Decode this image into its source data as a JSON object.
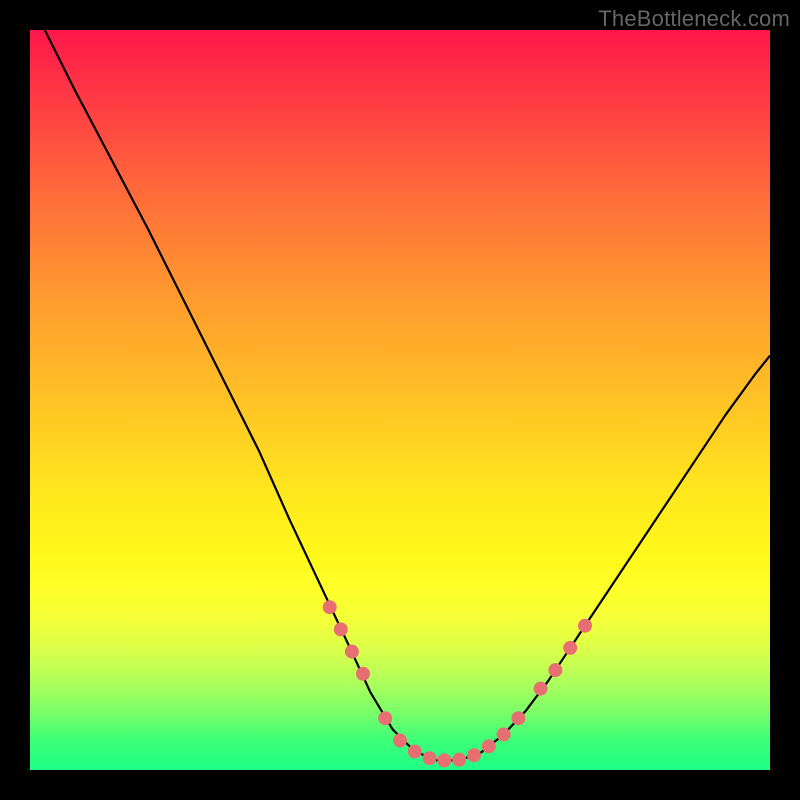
{
  "watermark": "TheBottleneck.com",
  "chart_data": {
    "type": "line",
    "title": "",
    "xlabel": "",
    "ylabel": "",
    "xlim": [
      0,
      100
    ],
    "ylim": [
      0,
      100
    ],
    "curve": {
      "name": "bottleneck-curve",
      "points": [
        {
          "x": 2.0,
          "y": 100.0
        },
        {
          "x": 6.0,
          "y": 92.0
        },
        {
          "x": 11.0,
          "y": 82.5
        },
        {
          "x": 16.0,
          "y": 73.0
        },
        {
          "x": 21.0,
          "y": 63.0
        },
        {
          "x": 26.0,
          "y": 53.0
        },
        {
          "x": 31.0,
          "y": 43.0
        },
        {
          "x": 35.0,
          "y": 34.0
        },
        {
          "x": 39.0,
          "y": 25.5
        },
        {
          "x": 43.0,
          "y": 17.0
        },
        {
          "x": 46.0,
          "y": 10.5
        },
        {
          "x": 49.0,
          "y": 5.5
        },
        {
          "x": 52.0,
          "y": 2.5
        },
        {
          "x": 55.0,
          "y": 1.3
        },
        {
          "x": 58.0,
          "y": 1.3
        },
        {
          "x": 61.0,
          "y": 2.4
        },
        {
          "x": 64.0,
          "y": 4.8
        },
        {
          "x": 67.0,
          "y": 8.0
        },
        {
          "x": 70.0,
          "y": 12.0
        },
        {
          "x": 74.0,
          "y": 18.0
        },
        {
          "x": 78.0,
          "y": 24.0
        },
        {
          "x": 82.0,
          "y": 30.0
        },
        {
          "x": 86.0,
          "y": 36.0
        },
        {
          "x": 90.0,
          "y": 42.0
        },
        {
          "x": 94.0,
          "y": 48.0
        },
        {
          "x": 98.0,
          "y": 53.5
        },
        {
          "x": 100.0,
          "y": 56.0
        }
      ]
    },
    "markers": {
      "name": "highlight-dots",
      "color": "#e76f72",
      "radius_px": 7,
      "points": [
        {
          "x": 40.5,
          "y": 22.0
        },
        {
          "x": 42.0,
          "y": 19.0
        },
        {
          "x": 43.5,
          "y": 16.0
        },
        {
          "x": 45.0,
          "y": 13.0
        },
        {
          "x": 48.0,
          "y": 7.0
        },
        {
          "x": 50.0,
          "y": 4.0
        },
        {
          "x": 52.0,
          "y": 2.5
        },
        {
          "x": 54.0,
          "y": 1.6
        },
        {
          "x": 56.0,
          "y": 1.3
        },
        {
          "x": 58.0,
          "y": 1.4
        },
        {
          "x": 60.0,
          "y": 2.0
        },
        {
          "x": 62.0,
          "y": 3.2
        },
        {
          "x": 64.0,
          "y": 4.8
        },
        {
          "x": 66.0,
          "y": 7.0
        },
        {
          "x": 69.0,
          "y": 11.0
        },
        {
          "x": 71.0,
          "y": 13.5
        },
        {
          "x": 73.0,
          "y": 16.5
        },
        {
          "x": 75.0,
          "y": 19.5
        }
      ]
    }
  }
}
